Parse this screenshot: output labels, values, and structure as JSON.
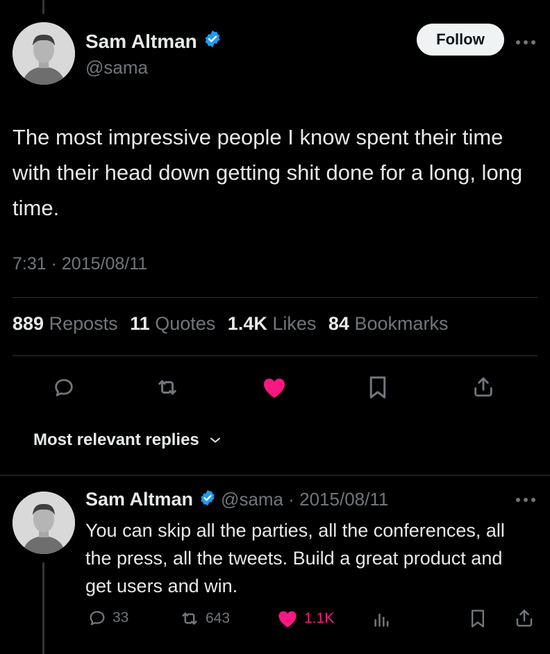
{
  "tweet": {
    "author_name": "Sam Altman",
    "handle": "@sama",
    "follow_label": "Follow",
    "text": "The most impressive people I know spent their time with their head down getting shit done for a long, long time.",
    "time": "7:31",
    "date": "2015/08/11",
    "timestamp_sep": " · ",
    "stats": {
      "reposts_count": "889",
      "reposts_label": "Reposts",
      "quotes_count": "11",
      "quotes_label": "Quotes",
      "likes_count": "1.4K",
      "likes_label": "Likes",
      "bookmarks_count": "84",
      "bookmarks_label": "Bookmarks"
    }
  },
  "replies_filter": {
    "label": "Most relevant replies"
  },
  "reply": {
    "author_name": "Sam Altman",
    "handle_date": "@sama · 2015/08/11",
    "text": "You can skip all the parties, all the conferences, all the press, all the tweets. Build a great product and get users and win.",
    "reply_count": "33",
    "repost_count": "643",
    "like_count": "1.1K"
  },
  "colors": {
    "background": "#000000",
    "text": "#e7e9ea",
    "secondary": "#71767b",
    "verified": "#1d9bf0",
    "like": "#f91880",
    "divider": "#2f3336"
  },
  "icons": [
    "verified-badge-icon",
    "more-icon",
    "reply-icon",
    "repost-icon",
    "heart-icon",
    "bookmark-icon",
    "share-icon",
    "chevron-down-icon",
    "analytics-icon"
  ]
}
